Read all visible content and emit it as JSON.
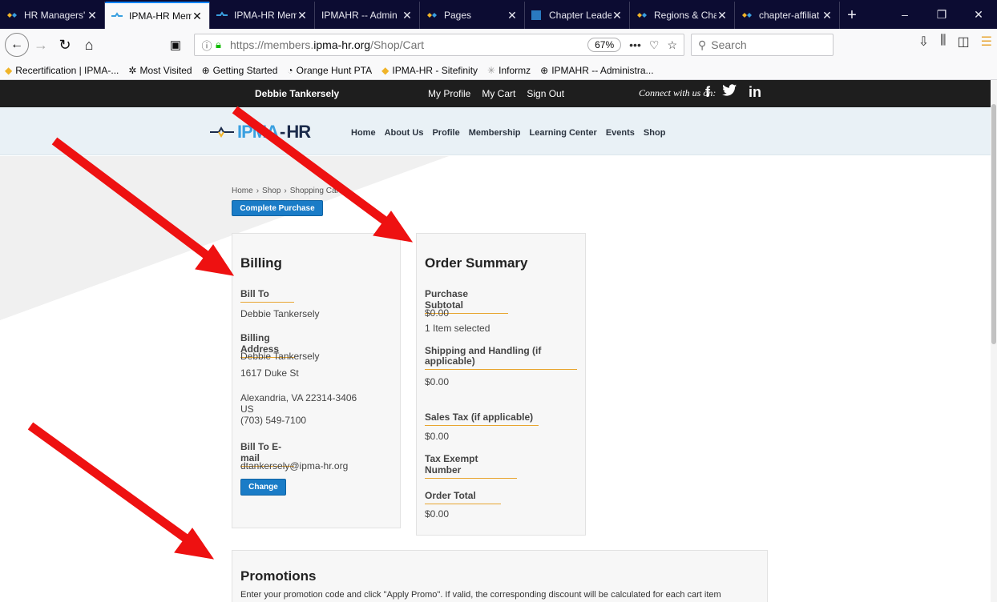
{
  "browser": {
    "tabs": [
      {
        "title": "HR Managers' N",
        "active": false
      },
      {
        "title": "IPMA-HR Mem",
        "active": true
      },
      {
        "title": "IPMA-HR Mem",
        "active": false
      },
      {
        "title": "IPMAHR -- Admin",
        "active": false
      },
      {
        "title": "Pages",
        "active": false
      },
      {
        "title": "Chapter Leade",
        "active": false
      },
      {
        "title": "Regions & Cha",
        "active": false
      },
      {
        "title": "chapter-affiliat",
        "active": false
      }
    ],
    "url_prefix": "https://members.",
    "url_domain": "ipma-hr.org",
    "url_path": "/Shop/Cart",
    "zoom": "67%",
    "search_placeholder": "Search",
    "bookmarks": [
      {
        "label": "Recertification | IPMA-..."
      },
      {
        "label": "Most Visited"
      },
      {
        "label": "Getting Started"
      },
      {
        "label": "Orange Hunt PTA"
      },
      {
        "label": "IPMA-HR - Sitefinity"
      },
      {
        "label": "Informz"
      },
      {
        "label": "IPMAHR -- Administra..."
      }
    ]
  },
  "site": {
    "user_name": "Debbie Tankersely",
    "top_links": [
      "My Profile",
      "My Cart",
      "Sign Out"
    ],
    "connect_text": "Connect with us on:",
    "social": [
      "f",
      "in"
    ],
    "logo_text": "HR",
    "logo_prefix": "IPMA",
    "nav": [
      "Home",
      "About Us",
      "Profile",
      "Membership",
      "Learning Center",
      "Events",
      "Shop"
    ],
    "breadcrumb": [
      "Home",
      "Shop",
      "Shopping Cart"
    ],
    "complete_button": "Complete Purchase"
  },
  "billing": {
    "heading": "Billing",
    "bill_to_label": "Bill To",
    "bill_to_name": "Debbie Tankersely",
    "address_label": "Billing Address",
    "address_name": "Debbie Tankersely",
    "address_street": "1617 Duke St",
    "address_city": "Alexandria, VA 22314-3406",
    "address_country": "US",
    "address_phone": "(703) 549-7100",
    "email_label": "Bill To E-mail",
    "email": "dtankersely@ipma-hr.org",
    "change_button": "Change"
  },
  "order": {
    "heading": "Order Summary",
    "subtotal_label": "Purchase Subtotal",
    "subtotal": "$0.00",
    "items_selected": "1 Item selected",
    "shipping_label_1": "Shipping and Handling (if",
    "shipping_label_2": "applicable)",
    "shipping": "$0.00",
    "tax_label": "Sales Tax (if applicable)",
    "tax": "$0.00",
    "exempt_label": "Tax Exempt Number",
    "total_label": "Order Total",
    "total": "$0.00"
  },
  "promotions": {
    "heading": "Promotions",
    "text": "Enter your promotion code and click \"Apply Promo\". If valid, the corresponding discount will be calculated for each cart item"
  },
  "colors": {
    "accent_button": "#1a7cc7",
    "label_underline": "#e8a531",
    "annotation_arrow": "#ee1111",
    "tab_bar": "#0c0c32"
  }
}
